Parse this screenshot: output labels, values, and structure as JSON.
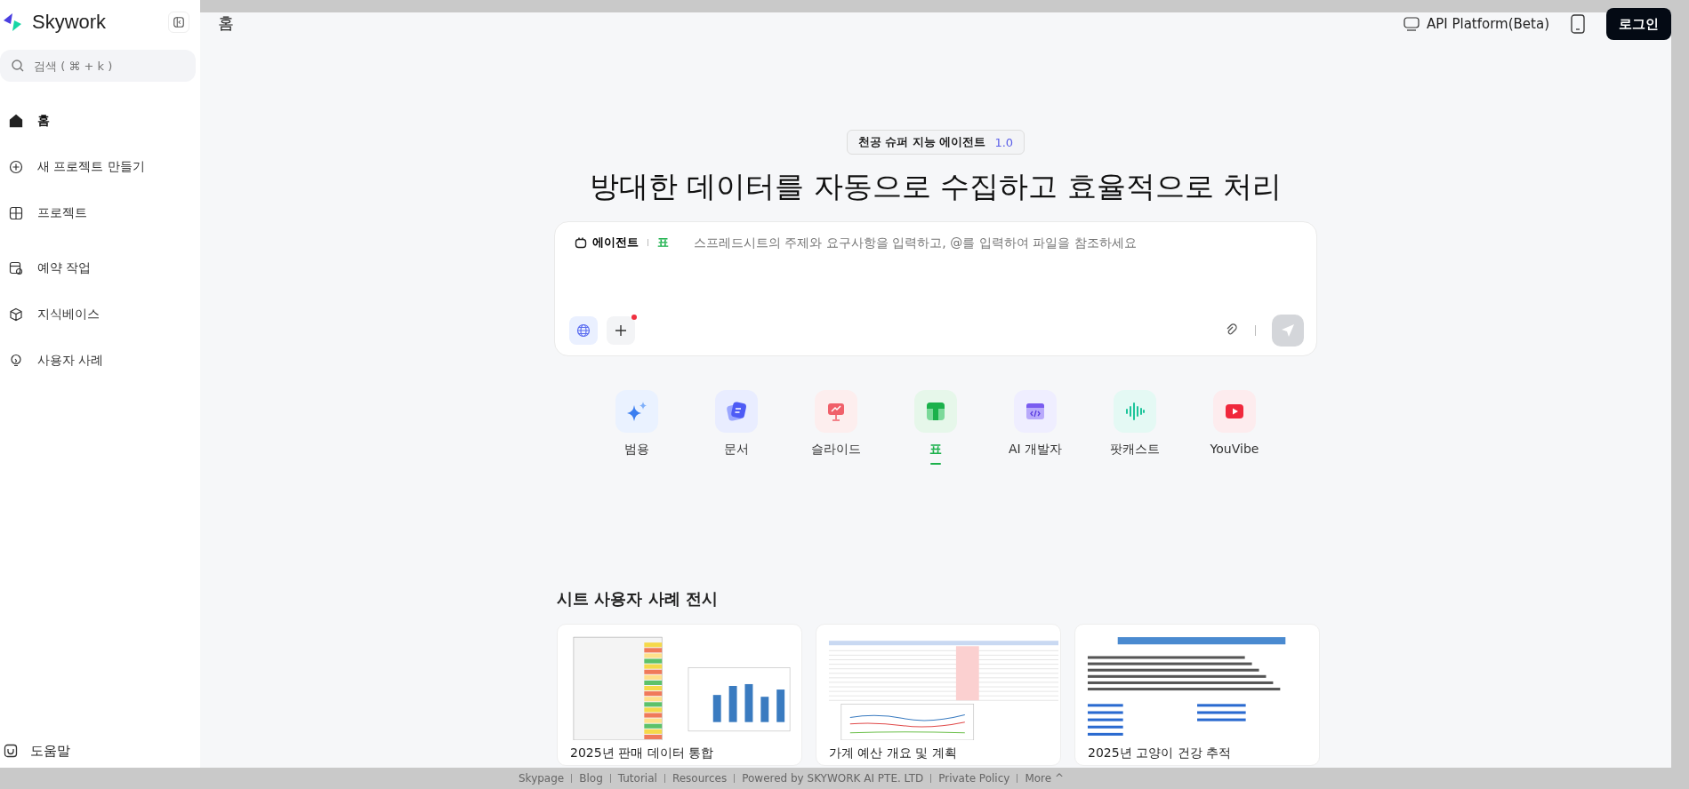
{
  "sidebar": {
    "brand": "Skywork",
    "search": {
      "placeholder": "검색 ( ⌘ + k )"
    },
    "items": [
      {
        "label": "홈",
        "kind": "home",
        "selected": true
      },
      {
        "label": "새 프로젝트 만들기",
        "kind": "plus",
        "selected": false
      },
      {
        "label": "프로젝트",
        "kind": "grid",
        "selected": false
      },
      {
        "label": "예약 작업",
        "kind": "schedule",
        "selected": false
      },
      {
        "label": "지식베이스",
        "kind": "cube",
        "selected": false
      },
      {
        "label": "사용자 사례",
        "kind": "bulb",
        "selected": false
      }
    ],
    "help": "도움말"
  },
  "header": {
    "title": "홈",
    "api_link": "API Platform(Beta)",
    "login": "로그인"
  },
  "hero": {
    "badge": "천공 슈퍼 지능 에이전트",
    "version": "1.0",
    "headline": "방대한 데이터를 자동으로 수집하고 효율적으로 처리"
  },
  "composer": {
    "agent": "에이전트",
    "mode": "표",
    "placeholder": "스프레드시트의 주제와 요구사항을 입력하고, @를 입력하여 파일을 참조하세요",
    "plus_notification": true
  },
  "tools": [
    {
      "label": "범용",
      "kind": "sparkle",
      "color": "#eaf2ff",
      "selected": false
    },
    {
      "label": "문서",
      "kind": "doc",
      "color": "#e9edff",
      "selected": false
    },
    {
      "label": "슬라이드",
      "kind": "slide",
      "color": "#fdeeee",
      "selected": false
    },
    {
      "label": "표",
      "kind": "sheet",
      "color": "#e6f7ea",
      "selected": true
    },
    {
      "label": "AI 개발자",
      "kind": "code",
      "color": "#efeeff",
      "selected": false
    },
    {
      "label": "팟캐스트",
      "kind": "wave",
      "color": "#e4f9f4",
      "selected": false
    },
    {
      "label": "YouVibe",
      "kind": "video",
      "color": "#fdecee",
      "selected": false
    }
  ],
  "showcase": {
    "title": "시트 사용자 사례 전시",
    "cards": [
      {
        "title": "2025년 판매 데이터 통합",
        "kind": "chart"
      },
      {
        "title": "가계 예산 개요 및 계획",
        "kind": "budget"
      },
      {
        "title": "2025년 고양이 건강 추적",
        "kind": "template"
      }
    ]
  },
  "footer": [
    "Skypage",
    "Blog",
    "Tutorial",
    "Resources",
    "Powered by SKYWORK AI PTE. LTD",
    "Private Policy",
    "More ^"
  ]
}
